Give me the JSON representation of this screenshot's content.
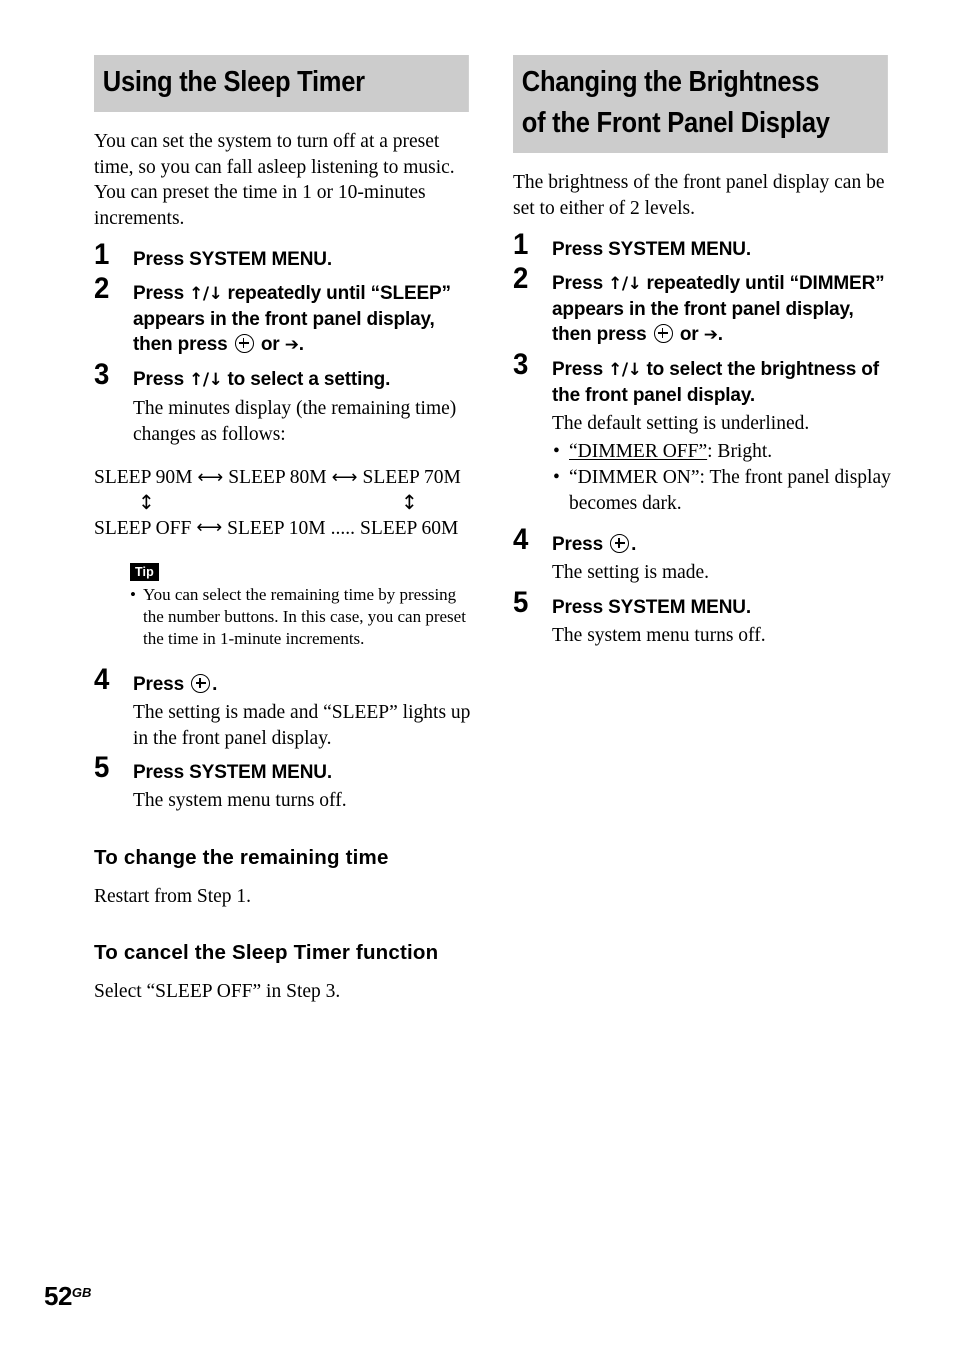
{
  "page": {
    "number": "52",
    "region_code": "GB"
  },
  "left_column": {
    "heading": "Using the Sleep Timer",
    "intro": "You can set the system to turn off at a preset time, so you can fall asleep listening to music. You can preset the time in 1 or 10-minutes increments.",
    "steps": [
      {
        "num": "1",
        "title_parts": {
          "a": "Press SYSTEM MENU.",
          "b": "",
          "c": ""
        }
      },
      {
        "num": "2",
        "title_parts": {
          "a": "Press ",
          "arrows": "↑/↓",
          "b": " repeatedly until “SLEEP” appears in the front panel display, then press ",
          "c": " or ",
          "rarrow": "➔",
          "d": "."
        }
      },
      {
        "num": "3",
        "title_parts": {
          "a": "Press ",
          "arrows": "↑/↓",
          "b": " to select a setting."
        },
        "desc": "The minutes display (the remaining time) changes as follows:"
      },
      {
        "num": "4",
        "title_parts": {
          "a": "Press ",
          "d": "."
        },
        "desc": "The setting is made and “SLEEP” lights up in the front panel display."
      },
      {
        "num": "5",
        "title_parts": {
          "a": "Press SYSTEM MENU."
        },
        "desc": "The system menu turns off."
      }
    ],
    "cycle": {
      "row1": [
        "SLEEP 90M",
        "SLEEP 80M",
        "SLEEP 70M"
      ],
      "row2": [
        "SLEEP  OFF",
        "SLEEP 10M",
        "SLEEP 60M"
      ],
      "h_arrow": "⟷",
      "v_arrow": "↕",
      "ellipsis": ".....",
      "row2_sep": "⟷"
    },
    "tip": {
      "badge": "Tip",
      "bullet": "•",
      "text": "You can select the remaining time by pressing the number buttons. In this case, you can preset the time in 1-minute increments."
    },
    "sub_sections": [
      {
        "heading": "To change the remaining time",
        "body": "Restart from Step 1."
      },
      {
        "heading": "To cancel the Sleep Timer function",
        "body": "Select “SLEEP  OFF” in Step 3."
      }
    ]
  },
  "right_column": {
    "heading_line1": "Changing the Brightness",
    "heading_line2": "of the Front Panel Display",
    "intro": "The brightness of the front panel display can be set to either of 2 levels.",
    "steps": [
      {
        "num": "1",
        "title_parts": {
          "a": "Press SYSTEM MENU."
        }
      },
      {
        "num": "2",
        "title_parts": {
          "a": "Press ",
          "arrows": "↑/↓",
          "b": " repeatedly until “DIMMER” appears in the front panel display, then press ",
          "c": " or ",
          "rarrow": "➔",
          "d": "."
        }
      },
      {
        "num": "3",
        "title_parts": {
          "a": "Press ",
          "arrows": "↑/↓",
          "b": " to select the brightness of the front panel display."
        },
        "desc": "The default setting is underlined."
      },
      {
        "num": "4",
        "title_parts": {
          "a": "Press ",
          "d": "."
        },
        "desc": "The setting is made."
      },
      {
        "num": "5",
        "title_parts": {
          "a": "Press SYSTEM MENU."
        },
        "desc": "The system menu turns off."
      }
    ],
    "bullets": [
      {
        "dot": "•",
        "underlined": "“DIMMER OFF”",
        "rest": ": Bright."
      },
      {
        "dot": "•",
        "underlined": "",
        "plain": "“DIMMER ON”: The front panel display becomes dark."
      }
    ]
  },
  "colors": {
    "heading_band": "#cccccc",
    "text": "#000000",
    "tip_badge_bg": "#000000"
  }
}
